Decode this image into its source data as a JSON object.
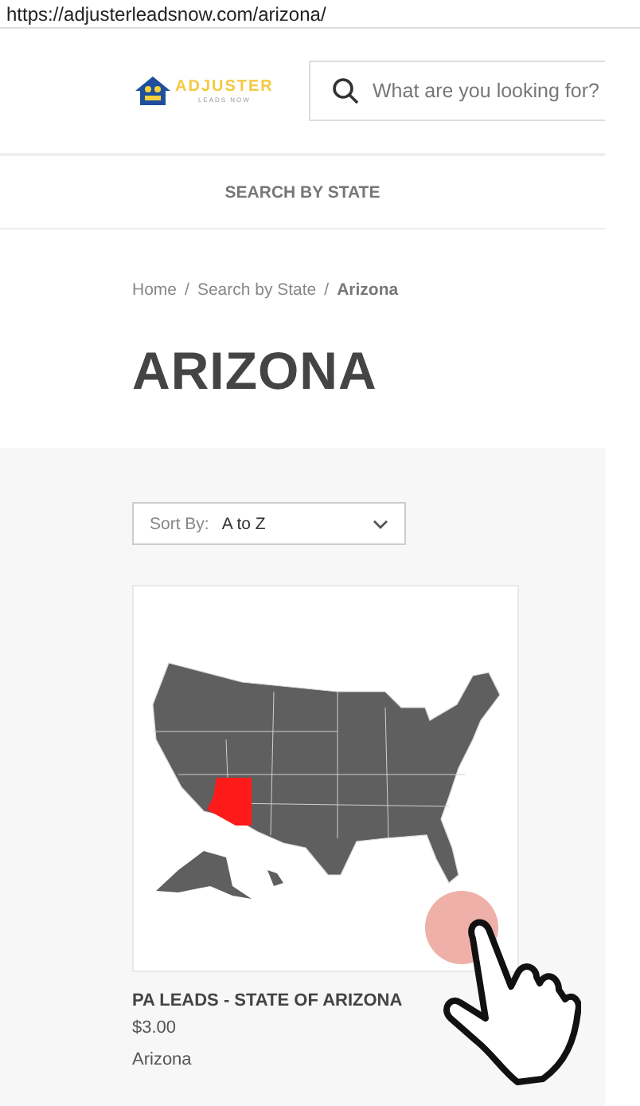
{
  "address_bar": {
    "url": "https://adjusterleadsnow.com/arizona/"
  },
  "header": {
    "logo": {
      "name": "ADJUSTER",
      "tagline": "LEADS NOW"
    },
    "search": {
      "placeholder": "What are you looking for?"
    }
  },
  "nav": {
    "items": [
      "SEARCH BY STATE"
    ]
  },
  "breadcrumb_separator": "/",
  "breadcrumb": [
    {
      "label": "Home",
      "current": false
    },
    {
      "label": "Search by State",
      "current": false
    },
    {
      "label": "Arizona",
      "current": true
    }
  ],
  "page_title": "ARIZONA",
  "sort": {
    "label": "Sort By:",
    "value": "A to Z"
  },
  "products": [
    {
      "name": "PA LEADS - STATE OF ARIZONA",
      "price": "$3.00",
      "category": "Arizona"
    }
  ]
}
